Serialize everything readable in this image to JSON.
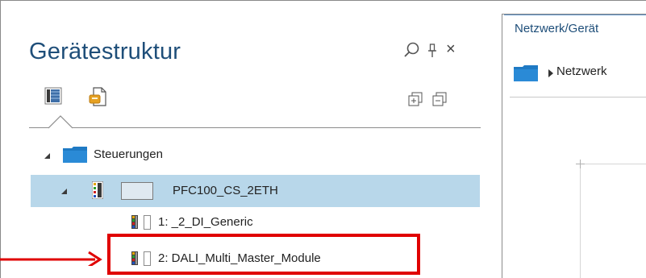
{
  "panel": {
    "title": "Gerätestruktur",
    "icons": [
      "search-icon",
      "pin-icon",
      "close-icon",
      "expand-all-icon",
      "collapse-all-icon"
    ],
    "close_glyph": "×"
  },
  "tree": {
    "controllers_label": "Steuerungen",
    "device_label": "PFC100_CS_2ETH",
    "modules": [
      {
        "label": "1: _2_DI_Generic"
      },
      {
        "label": "2: DALI_Multi_Master_Module"
      }
    ]
  },
  "right_panel": {
    "tab_label": "Netzwerk/Gerät",
    "network_label": "Netzwerk"
  },
  "colors": {
    "accent": "#1e4e79",
    "selection": "#b8d7ea",
    "highlight": "#e00000",
    "folder": "#1f7ac4"
  }
}
